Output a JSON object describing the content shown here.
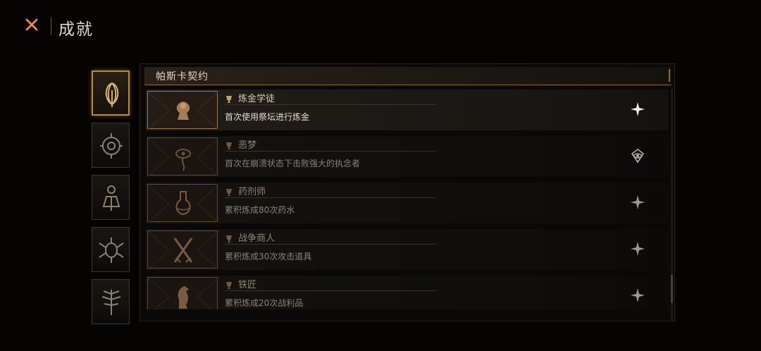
{
  "header": {
    "title": "成就"
  },
  "tabs": [
    {
      "icon": "pascal-crescent-icon",
      "active": true
    },
    {
      "icon": "compass-eye-icon",
      "active": false
    },
    {
      "icon": "flask-rune-icon",
      "active": false
    },
    {
      "icon": "winged-eye-icon",
      "active": false
    },
    {
      "icon": "tree-sigil-icon",
      "active": false
    }
  ],
  "panel": {
    "title": "帕斯卡契约",
    "achievements": [
      {
        "name": "炼金学徒",
        "desc": "首次使用祭坛进行炼金",
        "icon": "altar-icon",
        "unlocked": true,
        "status": "star-icon"
      },
      {
        "name": "恶梦",
        "desc": "首次在崩溃状态下击败强大的执念者",
        "icon": "nightmare-eye-icon",
        "unlocked": false,
        "status": "eye-sigil-icon"
      },
      {
        "name": "药剂师",
        "desc": "累积炼成80次药水",
        "icon": "potion-icon",
        "unlocked": false,
        "status": "star-icon"
      },
      {
        "name": "战争商人",
        "desc": "累积炼成30次攻击道具",
        "icon": "crossed-swords-icon",
        "unlocked": false,
        "status": "star-icon"
      },
      {
        "name": "铁匠",
        "desc": "累积炼成20次战利品",
        "icon": "forge-beast-icon",
        "unlocked": false,
        "status": "star-icon"
      }
    ]
  },
  "colors": {
    "accent": "#b58a4a",
    "close": "#e06a2a"
  }
}
